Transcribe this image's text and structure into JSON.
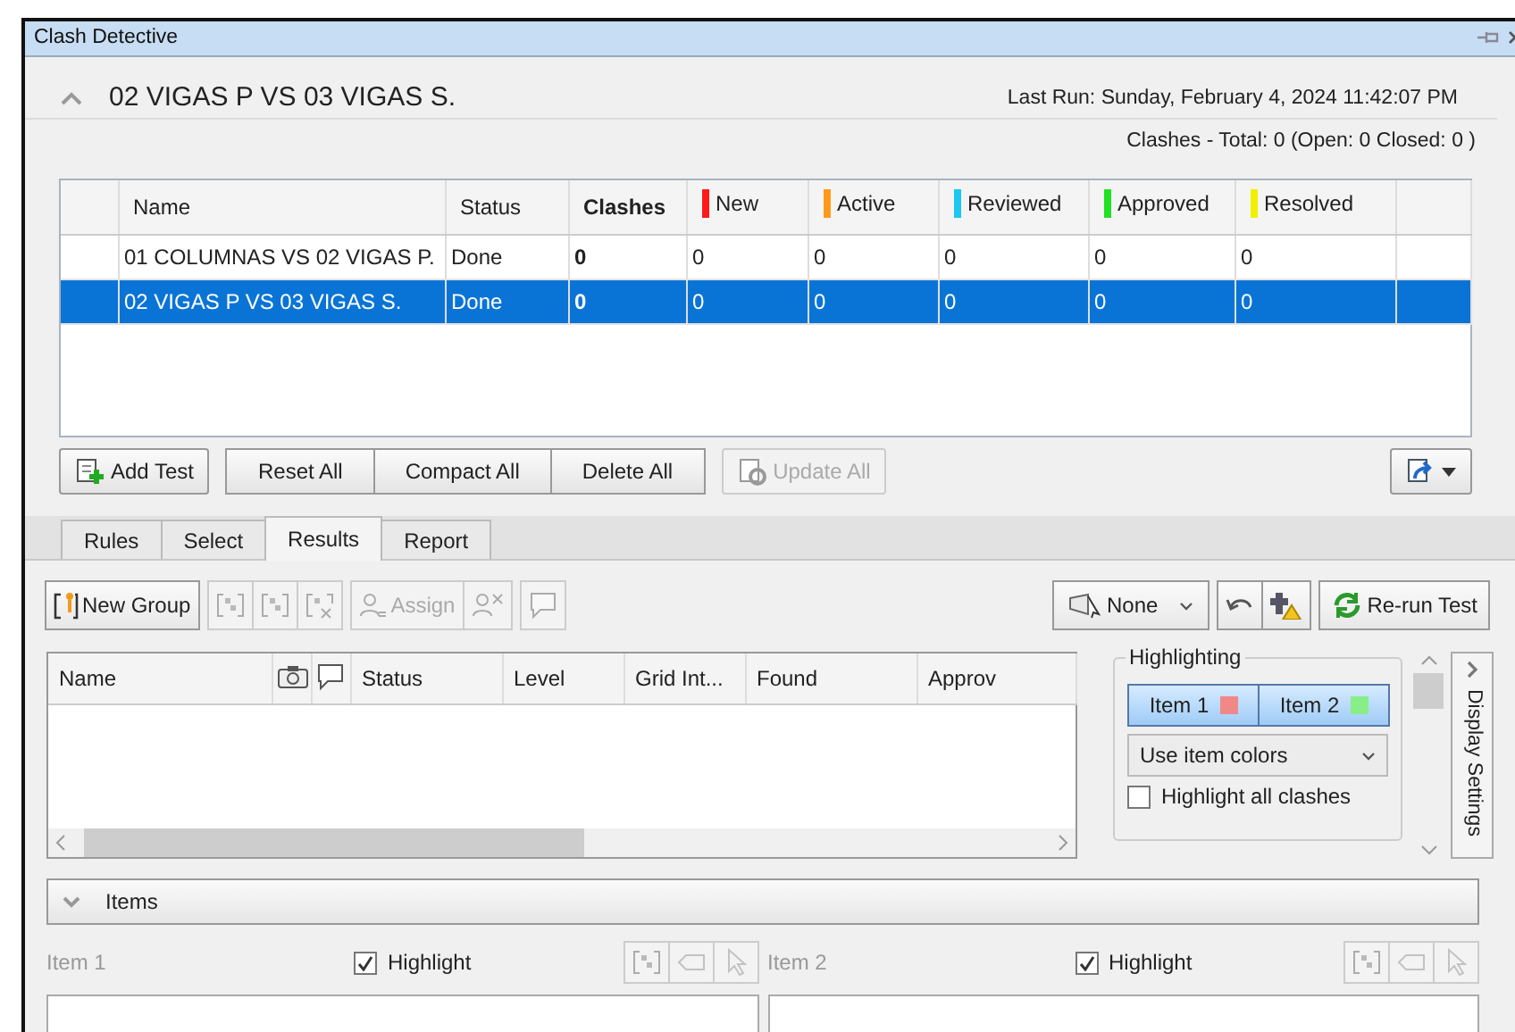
{
  "window": {
    "title": "Clash Detective"
  },
  "test_header": {
    "title": "02 VIGAS P VS 03 VIGAS S.",
    "expanded": true,
    "last_run": "Last Run:  Sunday, February 4, 2024 11:42:07 PM",
    "summary": "Clashes -  Total:  0  (Open:  0  Closed:  0 )"
  },
  "tests_table": {
    "columns": [
      {
        "label": "Name"
      },
      {
        "label": "Status"
      },
      {
        "label": "Clashes",
        "bold": true
      },
      {
        "label": "New",
        "color": "#ff1a1a"
      },
      {
        "label": "Active",
        "color": "#ff9a1a"
      },
      {
        "label": "Reviewed",
        "color": "#1ac8f0"
      },
      {
        "label": "Approved",
        "color": "#22e022"
      },
      {
        "label": "Resolved",
        "color": "#f0f000"
      }
    ],
    "rows": [
      {
        "selected": false,
        "cells": [
          "01 COLUMNAS VS 02 VIGAS P.",
          "Done",
          "0",
          "0",
          "0",
          "0",
          "0",
          "0"
        ]
      },
      {
        "selected": true,
        "cells": [
          "02 VIGAS P VS 03 VIGAS S.",
          "Done",
          "0",
          "0",
          "0",
          "0",
          "0",
          "0"
        ]
      }
    ]
  },
  "test_buttons": [
    {
      "kind": "add",
      "label": "Add Test",
      "disabled": false
    },
    {
      "kind": "joined",
      "label": "Reset All",
      "disabled": false
    },
    {
      "kind": "joined",
      "label": "Compact All",
      "disabled": false
    },
    {
      "kind": "joined",
      "label": "Delete All",
      "disabled": false
    },
    {
      "kind": "update",
      "label": "Update All",
      "disabled": true
    }
  ],
  "tabs": [
    {
      "label": "Rules",
      "selected": false
    },
    {
      "label": "Select",
      "selected": false
    },
    {
      "label": "Results",
      "selected": true
    },
    {
      "label": "Report",
      "selected": false
    }
  ],
  "results_toolbar": {
    "tools": [
      {
        "kind": "new-group",
        "label": "New Group",
        "disabled": false
      },
      {
        "kind": "group",
        "disabled": true
      },
      {
        "kind": "group",
        "disabled": true
      },
      {
        "kind": "ungroup",
        "disabled": true
      },
      {
        "kind": "assign",
        "label": "Assign",
        "disabled": true
      },
      {
        "kind": "unassign",
        "disabled": true
      },
      {
        "kind": "comment",
        "disabled": true
      }
    ],
    "filter": {
      "label": "None"
    },
    "rerun": {
      "label": "Re-run Test"
    }
  },
  "results_table": {
    "columns": [
      {
        "kind": "text",
        "label": "Name"
      },
      {
        "kind": "camera"
      },
      {
        "kind": "comment"
      },
      {
        "kind": "text",
        "label": "Status"
      },
      {
        "kind": "text",
        "label": "Level"
      },
      {
        "kind": "text",
        "label": "Grid Int..."
      },
      {
        "kind": "text",
        "label": "Found"
      },
      {
        "kind": "text",
        "label": "Approv"
      }
    ]
  },
  "highlighting": {
    "title": "Highlighting",
    "items": [
      {
        "label": "Item 1",
        "color": "#f08888",
        "selected": true
      },
      {
        "label": "Item 2",
        "color": "#88ee88",
        "selected": true
      }
    ],
    "mode": "Use item colors",
    "highlight_all": {
      "label": "Highlight all clashes",
      "checked": false
    }
  },
  "side_tab": {
    "label": "Display Settings"
  },
  "items_section": {
    "title": "Items",
    "expanded": true,
    "panes": [
      {
        "label": "Item 1",
        "highlight": {
          "label": "Highlight",
          "checked": true
        }
      },
      {
        "label": "Item 2",
        "highlight": {
          "label": "Highlight",
          "checked": true
        }
      }
    ]
  }
}
